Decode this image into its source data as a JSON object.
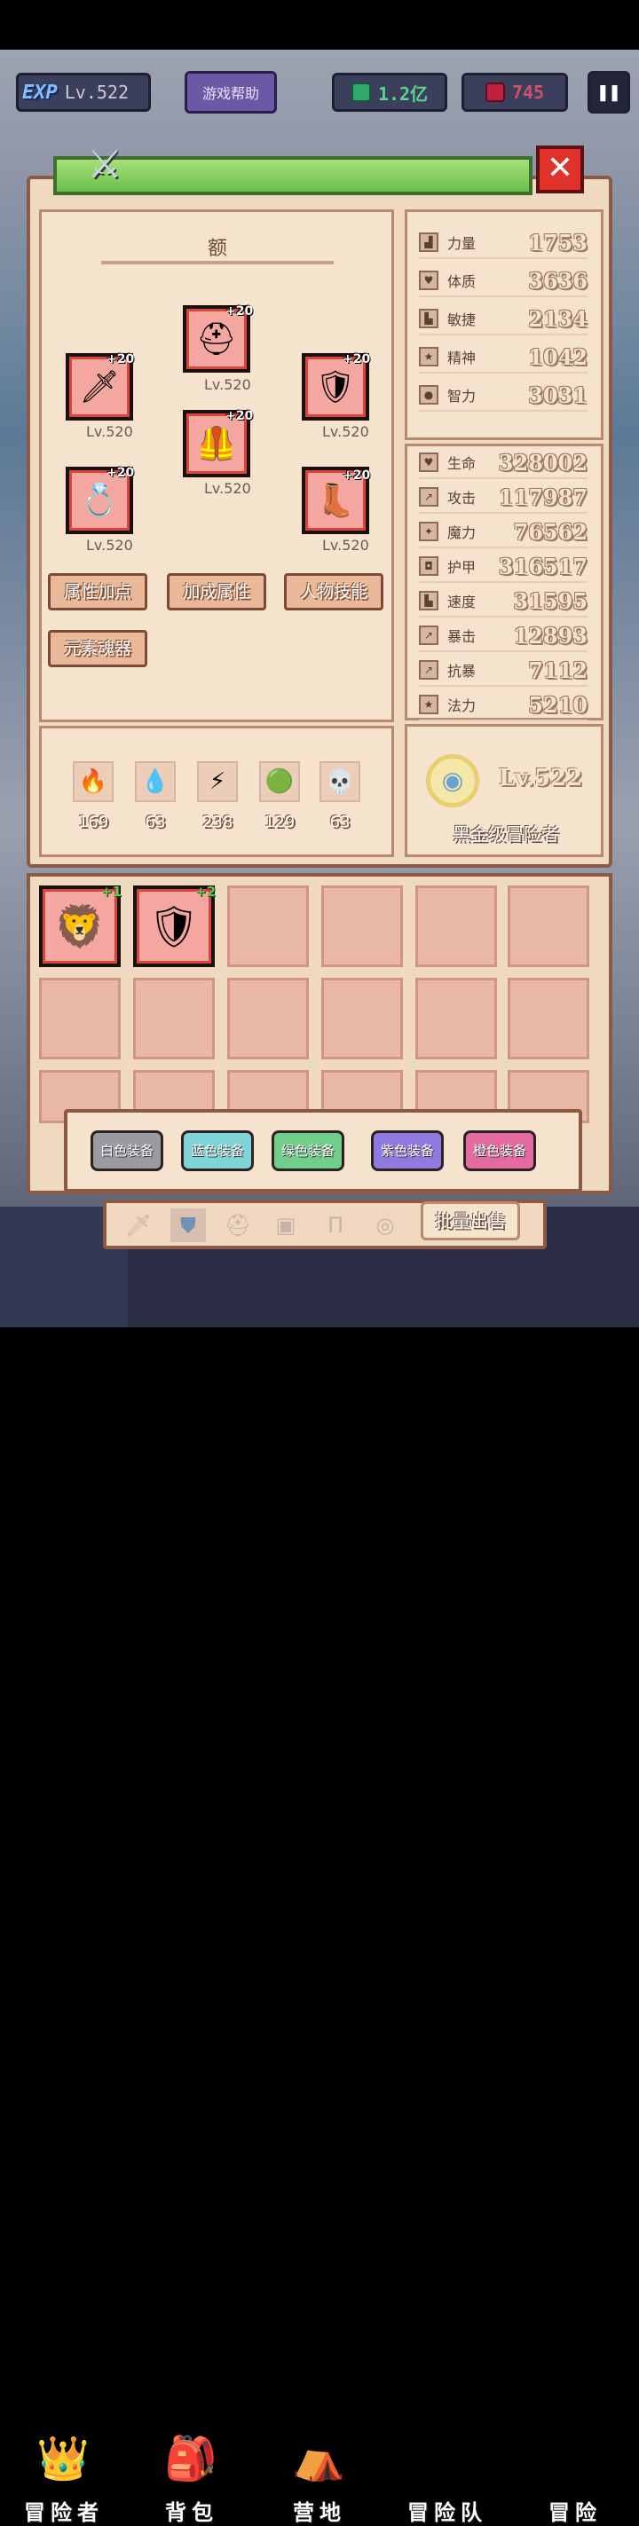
{
  "hud": {
    "exp_tag": "EXP",
    "level": "Lv.522",
    "help_label": "游戏帮助",
    "gems": "1.2亿",
    "rubies": "745",
    "pause_icon": "pause-icon"
  },
  "equip": {
    "title_char": "额",
    "slots": [
      {
        "name": "helmet",
        "plus": "+20",
        "level": "Lv.520",
        "icon": "helmet-icon"
      },
      {
        "name": "weapon",
        "plus": "+20",
        "level": "Lv.520",
        "icon": "sword-icon"
      },
      {
        "name": "shield",
        "plus": "+20",
        "level": "Lv.520",
        "icon": "shield-icon"
      },
      {
        "name": "armor",
        "plus": "+20",
        "level": "Lv.520",
        "icon": "armor-icon"
      },
      {
        "name": "ring",
        "plus": "+20",
        "level": "Lv.520",
        "icon": "ring-icon"
      },
      {
        "name": "boots",
        "plus": "+20",
        "level": "Lv.520",
        "icon": "boots-icon"
      }
    ],
    "buttons": [
      "属性加点",
      "加成属性",
      "人物技能",
      "元素魂器"
    ]
  },
  "elements": [
    {
      "icon": "fire-icon",
      "value": "169"
    },
    {
      "icon": "water-icon",
      "value": "63"
    },
    {
      "icon": "lightning-icon",
      "value": "238"
    },
    {
      "icon": "earth-icon",
      "value": "129"
    },
    {
      "icon": "skull-icon",
      "value": "63"
    }
  ],
  "base_stats": [
    {
      "label": "力量",
      "value": "1753"
    },
    {
      "label": "体质",
      "value": "3636"
    },
    {
      "label": "敏捷",
      "value": "2134"
    },
    {
      "label": "精神",
      "value": "1042"
    },
    {
      "label": "智力",
      "value": "3031"
    }
  ],
  "combat_stats": [
    {
      "label": "生命",
      "value": "328002"
    },
    {
      "label": "攻击",
      "value": "117987"
    },
    {
      "label": "魔力",
      "value": "76562"
    },
    {
      "label": "护甲",
      "value": "316517"
    },
    {
      "label": "速度",
      "value": "31595"
    },
    {
      "label": "暴击",
      "value": "12893"
    },
    {
      "label": "抗暴",
      "value": "7112"
    },
    {
      "label": "法力",
      "value": "5210"
    }
  ],
  "rank": {
    "level": "Lv.522",
    "title": "黑金级冒险者"
  },
  "inventory": {
    "items": [
      {
        "plus": "+1",
        "icon": "lion-shield-icon"
      },
      {
        "plus": "+2",
        "icon": "dark-shield-icon"
      }
    ]
  },
  "filters": [
    {
      "label": "白色装备",
      "color": "#9a9aa0"
    },
    {
      "label": "蓝色装备",
      "color": "#7fd4d8"
    },
    {
      "label": "绿色装备",
      "color": "#6fcf8a"
    },
    {
      "label": "紫色装备",
      "color": "#8f7ae0"
    },
    {
      "label": "橙色装备",
      "color": "#e46aa0"
    }
  ],
  "tabs": [
    "sword-tab-icon",
    "shield-tab-icon",
    "helmet-tab-icon",
    "armor-tab-icon",
    "pants-tab-icon",
    "ring-tab-icon"
  ],
  "sell_label": "批量出售",
  "nav": [
    {
      "label": "冒险者",
      "icon": "crown-icon"
    },
    {
      "label": "背包",
      "icon": "bag-icon"
    },
    {
      "label": "营地",
      "icon": "camp-icon"
    },
    {
      "label": "冒险队",
      "icon": "team-icon"
    },
    {
      "label": "冒险",
      "icon": "dagger-icon"
    }
  ]
}
